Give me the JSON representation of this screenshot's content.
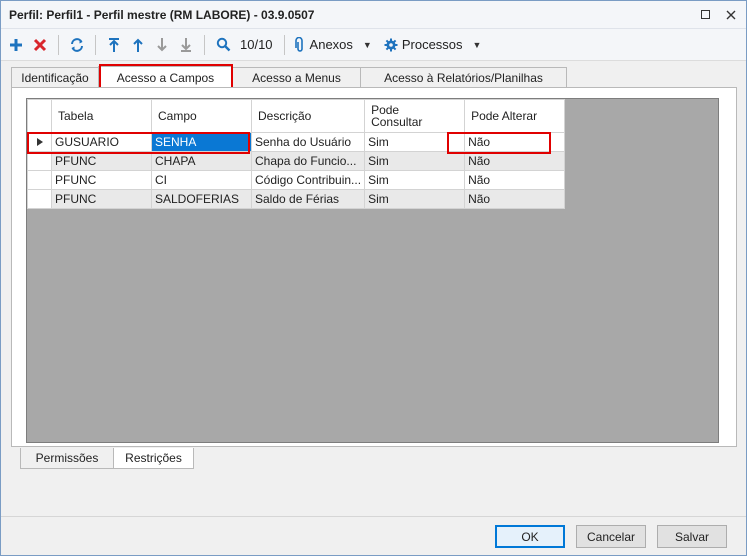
{
  "window": {
    "title": "Perfil: Perfil1 - Perfil mestre (RM LABORE) - 03.9.0507"
  },
  "toolbar": {
    "record_counter": "10/10",
    "anexos_label": "Anexos",
    "processos_label": "Processos"
  },
  "tabs": [
    {
      "label": "Identificação",
      "active": false
    },
    {
      "label": "Acesso a Campos",
      "active": true
    },
    {
      "label": "Acesso a Menus",
      "active": false
    },
    {
      "label": "Acesso à Relatórios/Planilhas",
      "active": false
    }
  ],
  "grid": {
    "columns": [
      "Tabela",
      "Campo",
      "Descrição",
      "Pode Consultar",
      "Pode Alterar"
    ],
    "rows": [
      {
        "tabela": "GUSUARIO",
        "campo": "SENHA",
        "descricao": "Senha do Usuário",
        "consultar": "Sim",
        "alterar": "Não"
      },
      {
        "tabela": "PFUNC",
        "campo": "CHAPA",
        "descricao": "Chapa do Funcio...",
        "consultar": "Sim",
        "alterar": "Não"
      },
      {
        "tabela": "PFUNC",
        "campo": "CI",
        "descricao": "Código Contribuin...",
        "consultar": "Sim",
        "alterar": "Não"
      },
      {
        "tabela": "PFUNC",
        "campo": "SALDOFERIAS",
        "descricao": "Saldo de Férias",
        "consultar": "Sim",
        "alterar": "Não"
      }
    ]
  },
  "subtabs": [
    {
      "label": "Permissões",
      "active": false
    },
    {
      "label": "Restrições",
      "active": true
    }
  ],
  "buttons": {
    "ok": "OK",
    "cancel": "Cancelar",
    "save": "Salvar"
  },
  "colors": {
    "selection": "#0a78d4",
    "highlight": "#e00000",
    "add_icon": "#1e73be",
    "delete_icon": "#d9262c"
  },
  "icons": {
    "add": "plus-icon",
    "delete": "x-icon",
    "refresh": "refresh-icon",
    "first": "arrow-first-icon",
    "prev": "arrow-up-icon",
    "next": "arrow-down-icon",
    "last": "arrow-last-icon",
    "search": "search-icon",
    "attach": "paperclip-icon",
    "processes": "gear-icon"
  }
}
